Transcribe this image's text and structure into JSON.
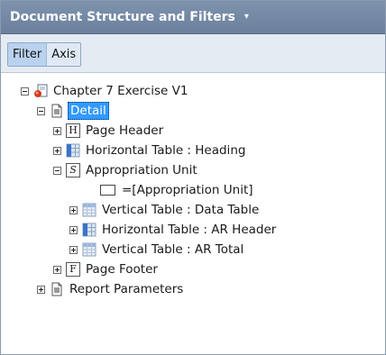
{
  "panel": {
    "title": "Document Structure and Filters",
    "menu_glyph": "▾"
  },
  "tabs": [
    "Filter",
    "Axis"
  ],
  "tree": [
    {
      "label": "Chapter 7 Exercise V1",
      "icon": "report-document-icon",
      "expander": "minus"
    },
    {
      "label": "Detail",
      "icon": "document-page-icon",
      "expander": "minus",
      "selected": true
    },
    {
      "label": "Page Header",
      "icon": "page-header-icon",
      "icon_letter": "H",
      "expander": "plus"
    },
    {
      "label": "Horizontal Table : Heading",
      "icon": "horizontal-table-icon",
      "expander": "plus"
    },
    {
      "label": "Appropriation Unit",
      "icon": "section-icon",
      "icon_letter": "S",
      "expander": "minus"
    },
    {
      "label": "=[Appropriation Unit]",
      "icon": "cell-icon",
      "expander": "none"
    },
    {
      "label": "Vertical Table : Data Table",
      "icon": "vertical-table-icon",
      "expander": "plus"
    },
    {
      "label": "Horizontal Table : AR Header",
      "icon": "horizontal-table-icon",
      "expander": "plus"
    },
    {
      "label": "Vertical Table : AR Total",
      "icon": "vertical-table-icon",
      "expander": "plus"
    },
    {
      "label": "Page Footer",
      "icon": "page-footer-icon",
      "icon_letter": "F",
      "expander": "plus"
    },
    {
      "label": "Report Parameters",
      "icon": "document-page-icon",
      "expander": "plus"
    }
  ],
  "colors": {
    "header": "#7a8fa9",
    "selection": "#3399ff",
    "tabbar": "#e4ebf3"
  }
}
